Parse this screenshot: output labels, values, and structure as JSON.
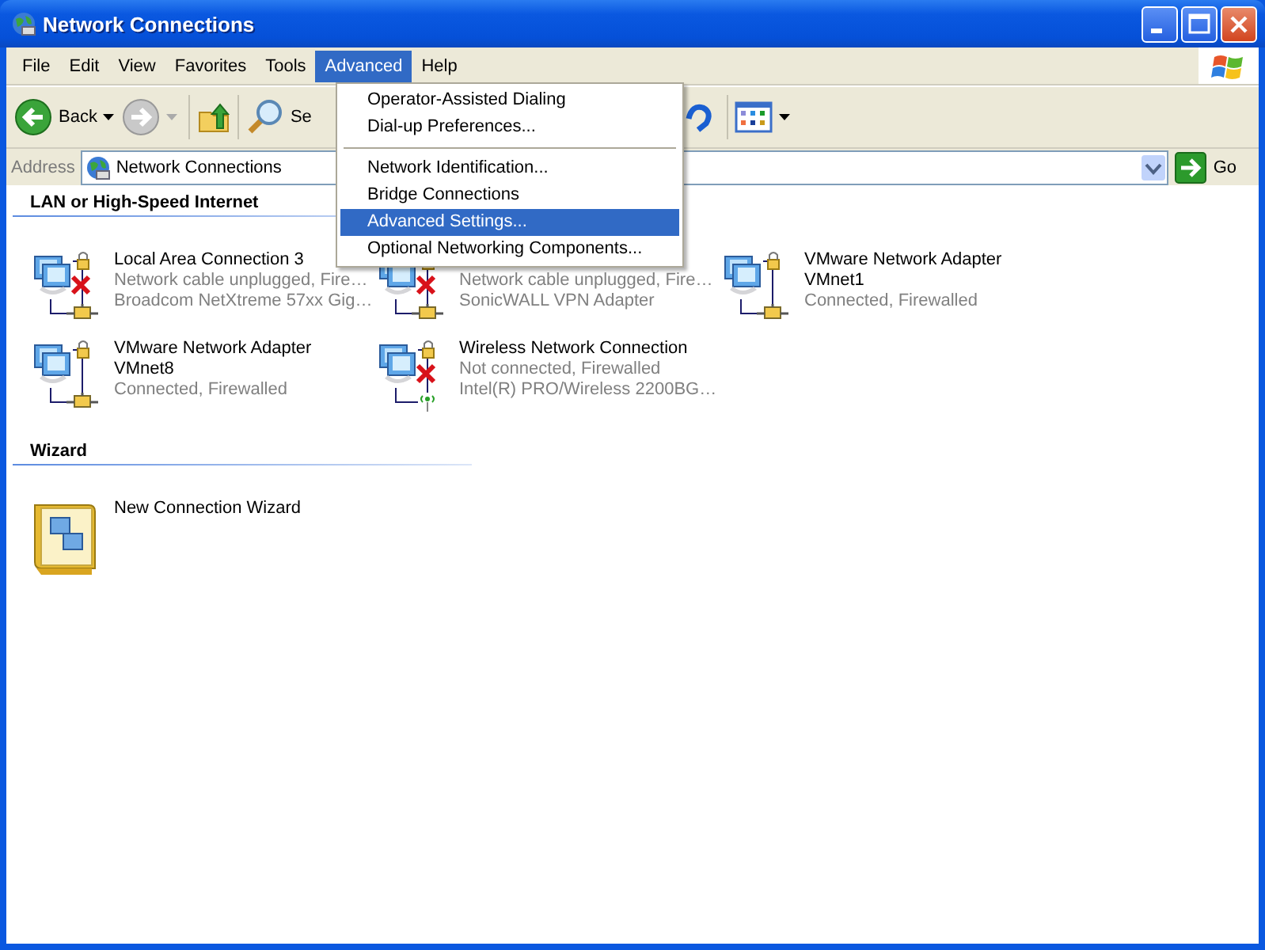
{
  "window": {
    "title": "Network Connections"
  },
  "menu_bar": [
    {
      "label": "File",
      "selected": false
    },
    {
      "label": "Edit",
      "selected": false
    },
    {
      "label": "View",
      "selected": false
    },
    {
      "label": "Favorites",
      "selected": false
    },
    {
      "label": "Tools",
      "selected": false
    },
    {
      "label": "Advanced",
      "selected": true
    },
    {
      "label": "Help",
      "selected": false
    }
  ],
  "toolbar": {
    "back": "Back",
    "search": "Se"
  },
  "address": {
    "label": "Address",
    "value": "Network Connections",
    "go": "Go"
  },
  "groups": [
    {
      "title": "LAN or High-Speed Internet",
      "items": [
        {
          "kind": "wired",
          "disconnected": true,
          "name": "Local Area Connection 3",
          "status": "Network cable unplugged, Fire…",
          "device": "Broadcom NetXtreme 57xx Gig…"
        },
        {
          "kind": "wired",
          "disconnected": true,
          "status": "Network cable unplugged, Fire…",
          "device": "SonicWALL VPN Adapter"
        },
        {
          "kind": "wired",
          "disconnected": false,
          "name": "VMware Network Adapter VMnet1",
          "status": "Connected, Firewalled"
        },
        {
          "kind": "wired",
          "disconnected": false,
          "name": "VMware Network Adapter VMnet8",
          "status": "Connected, Firewalled"
        },
        {
          "kind": "wireless",
          "disconnected": true,
          "name": "Wireless Network Connection",
          "status": "Not connected, Firewalled",
          "device": "Intel(R) PRO/Wireless 2200BG…"
        }
      ]
    },
    {
      "title": "Wizard",
      "items": [
        {
          "kind": "wizard",
          "name": "New Connection Wizard"
        }
      ]
    }
  ],
  "open_menu": [
    {
      "kind": "item",
      "label": "Operator-Assisted Dialing",
      "selected": false
    },
    {
      "kind": "item",
      "label": "Dial-up Preferences...",
      "selected": false
    },
    {
      "kind": "separator"
    },
    {
      "kind": "item",
      "label": "Network Identification...",
      "selected": false
    },
    {
      "kind": "item",
      "label": "Bridge Connections",
      "selected": false
    },
    {
      "kind": "item",
      "label": "Advanced Settings...",
      "selected": true
    },
    {
      "kind": "item",
      "label": "Optional Networking Components...",
      "selected": false
    }
  ]
}
